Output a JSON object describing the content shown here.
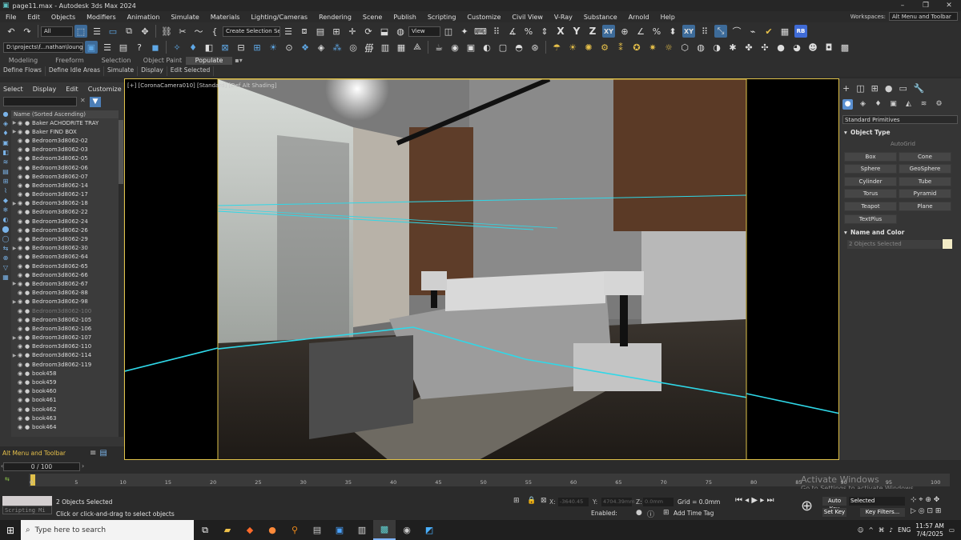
{
  "title": "page11.max - Autodesk 3ds Max 2024",
  "menu": [
    "File",
    "Edit",
    "Objects",
    "Modifiers",
    "Animation",
    "Simulate",
    "Materials",
    "Lighting/Cameras",
    "Rendering",
    "Scene",
    "Publish",
    "Scripting",
    "Customize",
    "Civil View",
    "V-Ray",
    "Substance",
    "Arnold",
    "Help"
  ],
  "workspace": {
    "label": "Workspaces:",
    "value": "Alt Menu and Toolbar"
  },
  "toolbar": {
    "selection_filter": "All",
    "named_selection": "Create Selection Se",
    "ref_coord": "View",
    "axis_x": "X",
    "axis_y": "Y",
    "axis_z": "Z",
    "axis_xy": "XY",
    "ortho": "XY",
    "user_badge": "RB",
    "project_path": "D:\\projects\\f...nathan\\lounge"
  },
  "ribbon": {
    "tabs": [
      "Modeling",
      "Freeform",
      "Selection",
      "Object Paint",
      "Populate"
    ],
    "active": "Populate",
    "sub": [
      "Define Flows",
      "Define Idle Areas",
      "Simulate",
      "Display",
      "Edit Selected"
    ]
  },
  "scene_explorer": {
    "menu": [
      "Select",
      "Display",
      "Edit",
      "Customize"
    ],
    "header": "Name (Sorted Ascending)",
    "items": [
      "Baker ACHODRITE TRAY",
      "Baker FIND BOX",
      "Bedroom3d8062-02",
      "Bedroom3d8062-03",
      "Bedroom3d8062-05",
      "Bedroom3d8062-06",
      "Bedroom3d8062-07",
      "Bedroom3d8062-14",
      "Bedroom3d8062-17",
      "Bedroom3d8062-18",
      "Bedroom3d8062-22",
      "Bedroom3d8062-24",
      "Bedroom3d8062-26",
      "Bedroom3d8062-29",
      "Bedroom3d8062-30",
      "Bedroom3d8062-64",
      "Bedroom3d8062-65",
      "Bedroom3d8062-66",
      "Bedroom3d8062-67",
      "Bedroom3d8062-88",
      "Bedroom3d8062-98",
      "Bedroom3d8062-100",
      "Bedroom3d8062-105",
      "Bedroom3d8062-106",
      "Bedroom3d8062-107",
      "Bedroom3d8062-110",
      "Bedroom3d8062-114",
      "Bedroom3d8062-119",
      "book458",
      "book459",
      "book460",
      "book461",
      "book462",
      "book463",
      "book464"
    ],
    "bottom_label": "Alt Menu and Toolbar",
    "frame": "0 / 100"
  },
  "viewport": {
    "label": "[+] [CoronaCamera010] [Standard] [Def Alt Shading]"
  },
  "command_panel": {
    "category": "Standard Primitives",
    "object_type_title": "Object Type",
    "autogrid": "AutoGrid",
    "buttons": [
      "Box",
      "Cone",
      "Sphere",
      "GeoSphere",
      "Cylinder",
      "Tube",
      "Torus",
      "Pyramid",
      "Teapot",
      "Plane",
      "TextPlus"
    ],
    "name_color_title": "Name and Color",
    "name_value": "2 Objects Selected",
    "obj_color": "#f3ecc6"
  },
  "timeline": {
    "ticks": [
      "0",
      "5",
      "10",
      "15",
      "20",
      "25",
      "30",
      "35",
      "40",
      "45",
      "50",
      "55",
      "60",
      "65",
      "70",
      "75",
      "80",
      "85",
      "90",
      "95",
      "100"
    ],
    "current_frame": 0
  },
  "status": {
    "maxscript": "Scripting Mi",
    "selected": "2 Objects Selected",
    "prompt": "Click or click-and-drag to select objects",
    "x_label": "X:",
    "x_value": "-3640.45",
    "y_label": "Y:",
    "y_value": "4704.39mm",
    "z_label": "Z:",
    "z_value": "0.0mm",
    "grid": "Grid = 0.0mm",
    "enabled": "Enabled:",
    "add_time_tag": "Add Time Tag",
    "auto_key": "Auto Key",
    "set_key": "Set Key",
    "selected_dd": "Selected",
    "key_filters": "Key Filters..."
  },
  "watermark": {
    "line1": "Activate Windows",
    "line2": "Go to Settings to activate Windows."
  },
  "taskbar": {
    "search": "Type here to search",
    "lang": "ENG",
    "time": "11:57 AM",
    "date": "7/4/2025"
  }
}
